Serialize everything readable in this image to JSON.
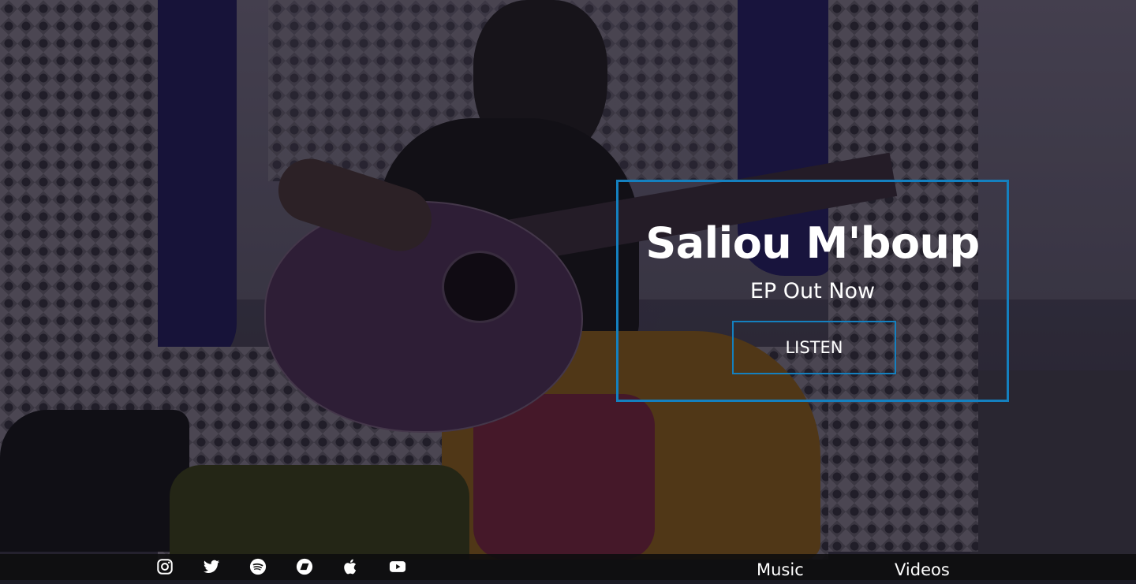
{
  "hero": {
    "title": "Saliou M'boup",
    "subtitle": "EP Out Now",
    "cta_label": "LISTEN",
    "accent_color": "#1480bf"
  },
  "social_links": [
    {
      "icon": "instagram-icon"
    },
    {
      "icon": "twitter-icon"
    },
    {
      "icon": "spotify-icon"
    },
    {
      "icon": "bandcamp-icon"
    },
    {
      "icon": "apple-music-icon"
    },
    {
      "icon": "youtube-icon"
    }
  ],
  "nav": {
    "music_label": "Music",
    "videos_label": "Videos"
  }
}
